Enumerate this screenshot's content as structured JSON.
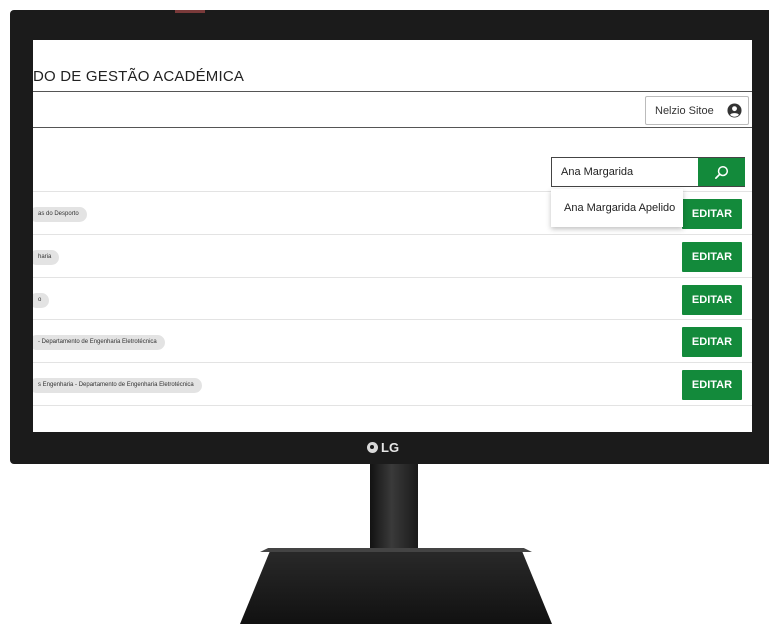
{
  "app": {
    "title": "DO DE GESTÃO ACADÉMICA"
  },
  "header": {
    "user_name": "Nelzio Sitoe"
  },
  "search": {
    "value": "Ana Margarida",
    "suggestion": "Ana Margarida Apelido"
  },
  "rows": [
    {
      "chip": "as do Desporto",
      "button": "EDITAR"
    },
    {
      "chip": "haria",
      "button": "EDITAR"
    },
    {
      "chip": "o",
      "button": "EDITAR"
    },
    {
      "chip": " - Departamento de Engenharia Eletrotécnica",
      "button": "EDITAR"
    },
    {
      "chip": "s Engenharia - Departamento de Engenharia Eletrotécnica",
      "button": "EDITAR"
    }
  ],
  "monitor": {
    "brand": "LG"
  },
  "colors": {
    "accent_green": "#138a3b",
    "bezel": "#1b1b1b",
    "chip_bg": "#e3e3e3"
  },
  "icons": {
    "user": "user-circle-icon",
    "search": "search-icon"
  }
}
